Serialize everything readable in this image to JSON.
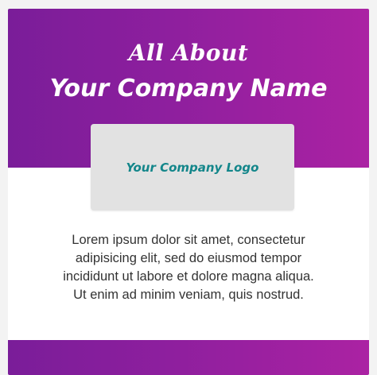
{
  "header": {
    "script_title": "All About",
    "main_title": "Your Company Name"
  },
  "logo": {
    "label": "Your Company Logo"
  },
  "content": {
    "paragraph_line_1": "Lorem ipsum dolor sit amet, consectetur",
    "paragraph_line_2": "adipisicing elit, sed do eiusmod tempor",
    "paragraph_line_3": "incididunt ut labore et dolore magna aliqua.",
    "paragraph_line_4": "Ut enim ad minim veniam, quis nostrud."
  },
  "colors": {
    "gradient_start": "#7a1d99",
    "gradient_end": "#ab22a3",
    "logo_text": "#13868a",
    "logo_box": "#e2e2e2",
    "body_text": "#333333"
  }
}
